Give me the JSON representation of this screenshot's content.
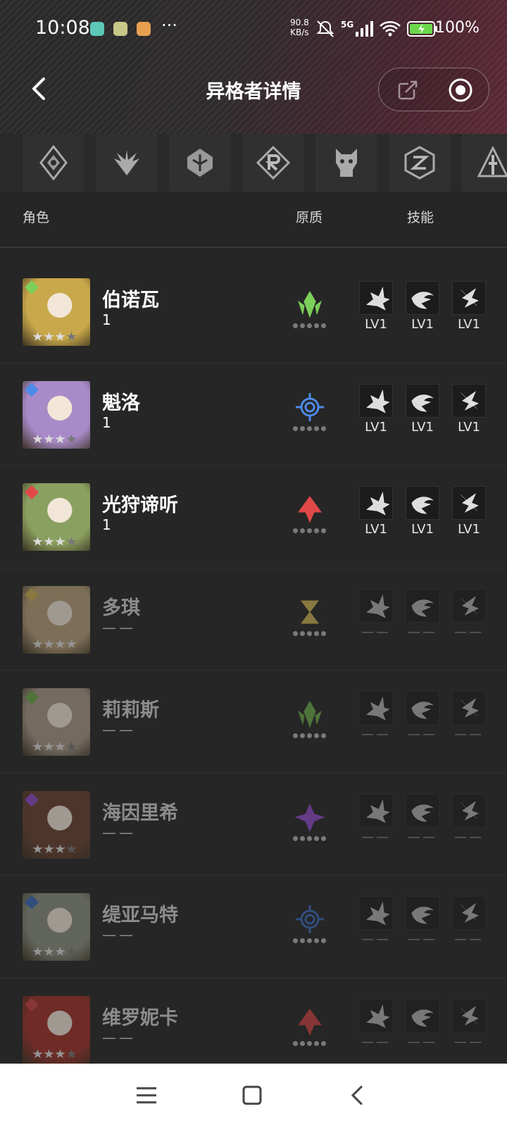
{
  "status": {
    "time": "10:08",
    "speed_value": "90.8",
    "speed_unit": "KB/s",
    "network": "5G",
    "battery": "100%"
  },
  "nav": {
    "title": "异格者详情"
  },
  "filters": [
    "shield-diamond",
    "winged-crest",
    "tower-emblem",
    "r-crest",
    "beast-head",
    "z-cube",
    "triangle-pillar"
  ],
  "columns": {
    "role": "角色",
    "quality": "原质",
    "skills": "技能"
  },
  "characters": [
    {
      "name": "伯诺瓦",
      "count": "1",
      "element": "green",
      "element_color": "#7ccf5a",
      "stars": 3,
      "locked": false,
      "skills": [
        "LV1",
        "LV1",
        "LV1"
      ],
      "portrait_color": "#c8a84a"
    },
    {
      "name": "魁洛",
      "count": "1",
      "element": "blue",
      "element_color": "#4e8be8",
      "stars": 3,
      "locked": false,
      "skills": [
        "LV1",
        "LV1",
        "LV1"
      ],
      "portrait_color": "#a88ac8"
    },
    {
      "name": "光狩谛听",
      "count": "1",
      "element": "red",
      "element_color": "#e04848",
      "stars": 3,
      "locked": false,
      "skills": [
        "LV1",
        "LV1",
        "LV1"
      ],
      "portrait_color": "#8aa060"
    },
    {
      "name": "多琪",
      "count": "——",
      "element": "gold",
      "element_color": "#c8b050",
      "stars": 4,
      "locked": true,
      "skills": [
        "——",
        "——",
        "——"
      ],
      "portrait_color": "#b8a078"
    },
    {
      "name": "莉莉斯",
      "count": "——",
      "element": "green",
      "element_color": "#6aa848",
      "stars": 3,
      "locked": true,
      "skills": [
        "——",
        "——",
        "——"
      ],
      "portrait_color": "#a89888"
    },
    {
      "name": "海因里希",
      "count": "——",
      "element": "purple",
      "element_color": "#9048c8",
      "stars": 3,
      "locked": true,
      "skills": [
        "——",
        "——",
        "——"
      ],
      "portrait_color": "#6a4030"
    },
    {
      "name": "缇亚马特",
      "count": "——",
      "element": "blue",
      "element_color": "#3a6ab8",
      "stars": 3,
      "locked": true,
      "skills": [
        "——",
        "——",
        "——"
      ],
      "portrait_color": "#8a9080"
    },
    {
      "name": "维罗妮卡",
      "count": "——",
      "element": "red",
      "element_color": "#c84040",
      "stars": 3,
      "locked": true,
      "skills": [
        "——",
        "——",
        "——"
      ],
      "portrait_color": "#a03028"
    }
  ],
  "colors": {
    "background": "#262626",
    "header_accent": "#5b2a36"
  }
}
